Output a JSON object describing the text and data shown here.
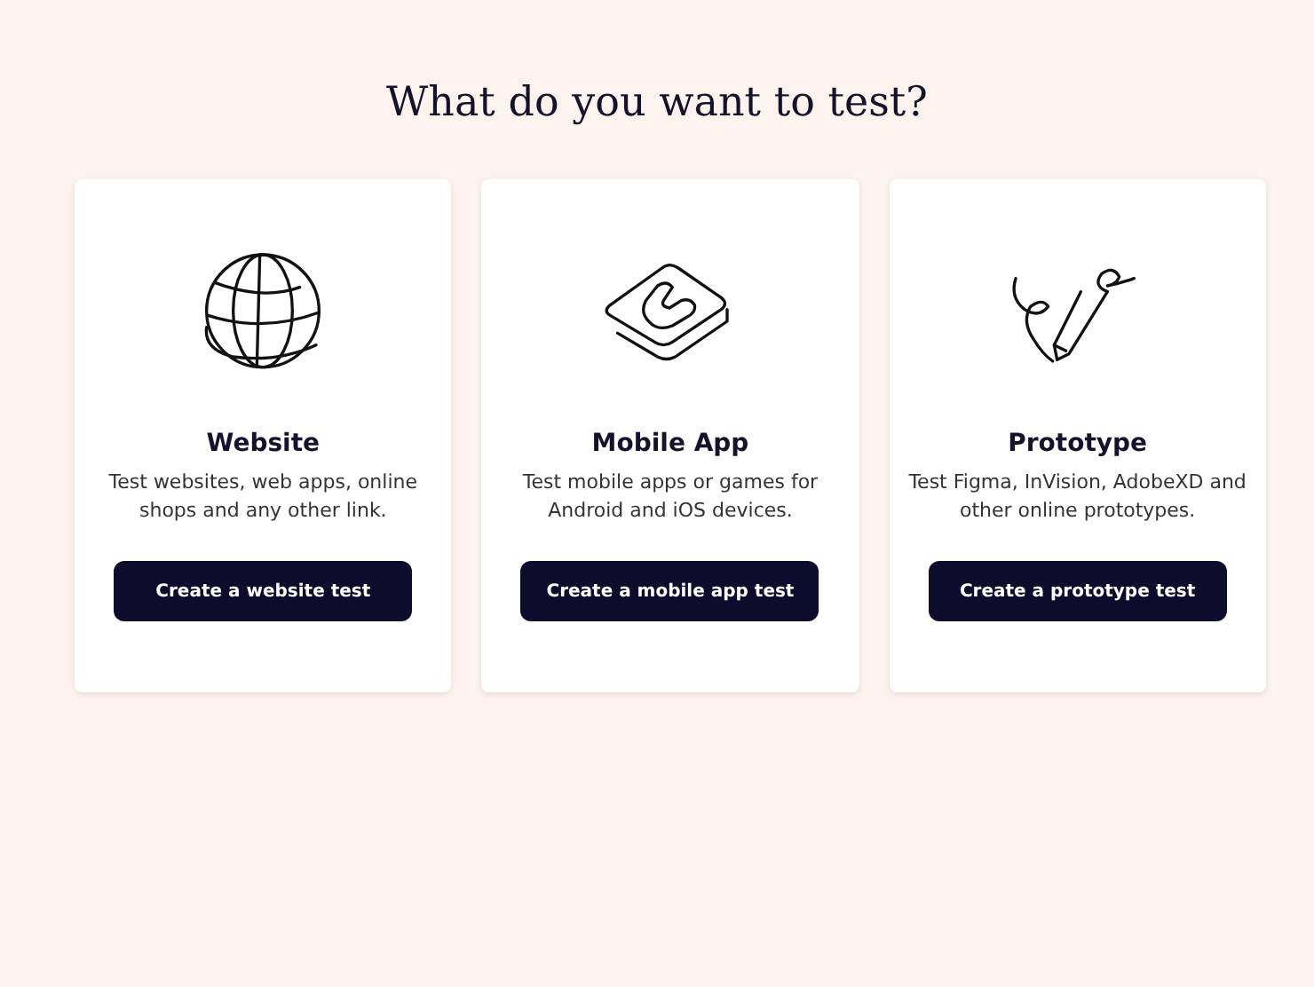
{
  "heading": "What do you want to test?",
  "options": [
    {
      "kind": "website",
      "title": "Website",
      "description": "Test websites, web apps, online shops and any other link.",
      "button": "Create a website test"
    },
    {
      "kind": "mobile",
      "title": "Mobile App",
      "description": "Test mobile apps or games for Android and iOS devices.",
      "button": "Create a mobile app test"
    },
    {
      "kind": "prototype",
      "title": "Prototype",
      "description": "Test Figma, InVision, AdobeXD and other online prototypes.",
      "button": "Create a prototype test"
    }
  ]
}
